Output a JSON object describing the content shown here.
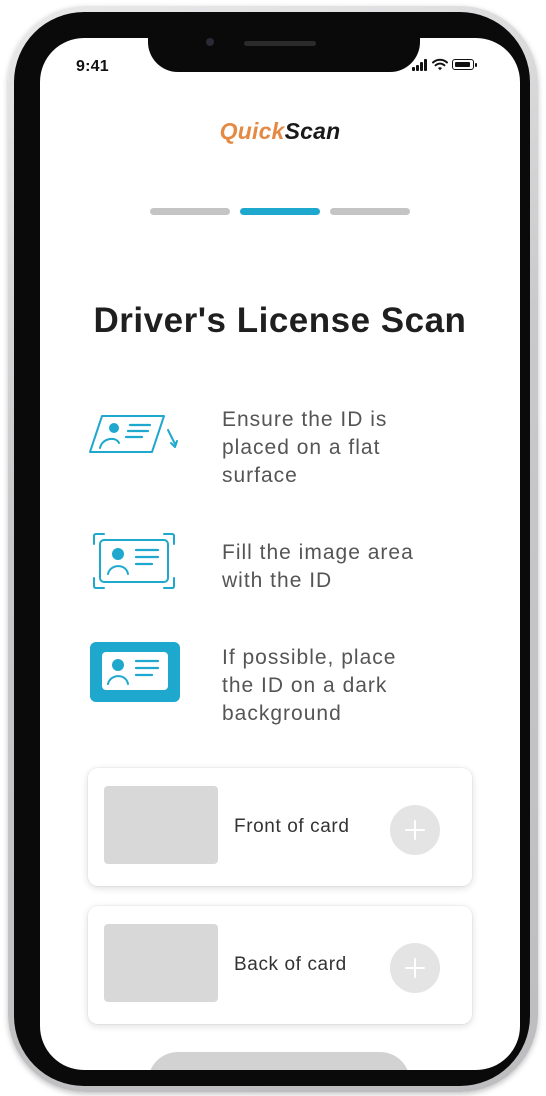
{
  "status_bar": {
    "time": "9:41",
    "icons": [
      "signal-icon",
      "wifi-icon",
      "battery-icon"
    ]
  },
  "brand": {
    "part1": "Quick",
    "part2": "Scan",
    "color_part1": "#e58a45",
    "color_part2": "#1a1a1a"
  },
  "progress": {
    "total_steps": 3,
    "current_step": 2,
    "active_color": "#1fa8cd",
    "inactive_color": "#c4c4c4"
  },
  "page": {
    "title": "Driver's License Scan"
  },
  "tips": [
    {
      "icon": "id-card-flat-surface-icon",
      "text": "Ensure the ID is\nplaced on a flat\nsurface"
    },
    {
      "icon": "id-card-frame-icon",
      "text": "Fill the image area\nwith the ID"
    },
    {
      "icon": "id-card-dark-background-icon",
      "text": "If possible, place\nthe ID on a dark\nbackground"
    }
  ],
  "upload_cards": [
    {
      "label": "Front of card",
      "add_icon": "plus-icon"
    },
    {
      "label": "Back of card",
      "add_icon": "plus-icon"
    }
  ],
  "colors": {
    "accent": "#1fa8cd",
    "placeholder": "#d8d8d8",
    "text_muted": "#555555"
  }
}
